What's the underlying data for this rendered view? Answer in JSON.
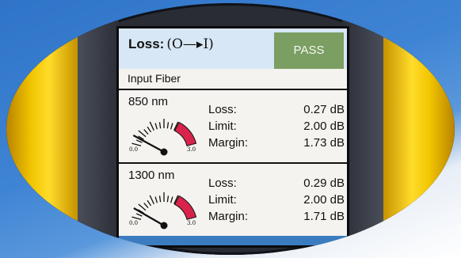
{
  "header": {
    "title_label": "Loss:",
    "title_formula": "(O—▸I)",
    "status": "PASS"
  },
  "section": {
    "label": "Input Fiber"
  },
  "colors": {
    "pass": "#7b9e62",
    "gauge_red": "#d8234a",
    "screen": "#f4f3ef",
    "device_accent": "#f2c500"
  },
  "measurements": [
    {
      "wavelength": "850 nm",
      "loss_label": "Loss:",
      "loss_value": "0.27 dB",
      "limit_label": "Limit:",
      "limit_value": "2.00 dB",
      "margin_label": "Margin:",
      "margin_value": "1.73 dB",
      "gauge_min": "0.0",
      "gauge_max": "3.0",
      "gauge_fraction": 0.09
    },
    {
      "wavelength": "1300 nm",
      "loss_label": "Loss:",
      "loss_value": "0.29 dB",
      "limit_label": "Limit:",
      "limit_value": "2.00 dB",
      "margin_label": "Margin:",
      "margin_value": "1.71 dB",
      "gauge_min": "0.0",
      "gauge_max": "3.0",
      "gauge_fraction": 0.1
    }
  ]
}
